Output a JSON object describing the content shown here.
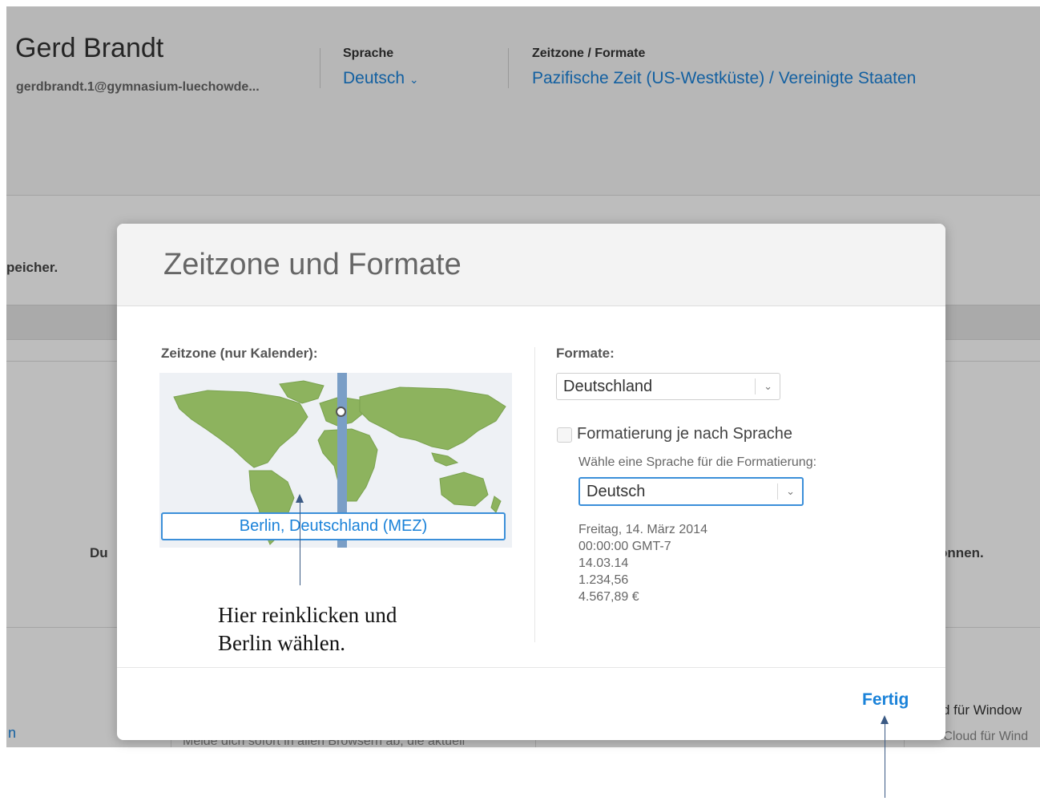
{
  "background": {
    "user_name": "Gerd Brandt",
    "user_email": "gerdbrandt.1@gymnasium-luechowde...",
    "language_label": "Sprache",
    "language_value": "Deutsch",
    "timezone_label": "Zeitzone / Formate",
    "timezone_value": "Pazifische Zeit (US-Westküste) / Vereinigte Staaten",
    "storage_fragment": "peicher.",
    "du_fragment": "Du",
    "koennen_fragment": "önnen.",
    "windows_fragment": "d für Window",
    "icloud_fragment": "Mit iCloud für Wind",
    "link_fragment": "n",
    "web_fragment": "Melde dich sofort in allen Browsern ab, die aktuell"
  },
  "modal": {
    "title": "Zeitzone und Formate",
    "timezone_label": "Zeitzone (nur Kalender):",
    "timezone_field": "Berlin, Deutschland (MEZ)",
    "formats_label": "Formate:",
    "formats_select": "Deutschland",
    "checkbox_label": "Formatierung je nach Sprache",
    "language_hint": "Wähle eine Sprache für die Formatierung:",
    "language_select": "Deutsch",
    "preview": [
      "Freitag, 14. März 2014",
      "00:00:00 GMT-7",
      "14.03.14",
      "1.234,56",
      "4.567,89 €"
    ],
    "done_button": "Fertig"
  },
  "annotations": {
    "instruction_line1": "Hier reinklicken und",
    "instruction_line2": "Berlin wählen."
  },
  "icons": {
    "chevron": "chevron-down-icon",
    "map": "world-map-icon"
  },
  "colors": {
    "accent": "#1a82d9",
    "land": "#8db35e",
    "timezone_band": "#7a9ec6"
  }
}
